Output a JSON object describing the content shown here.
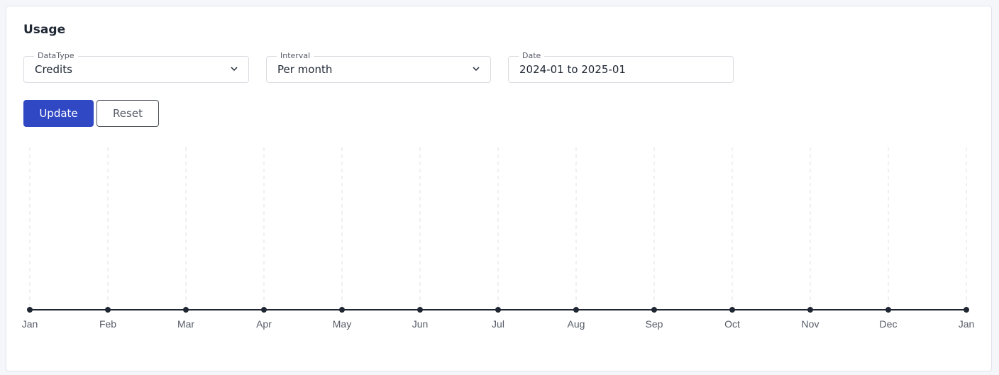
{
  "card": {
    "title": "Usage"
  },
  "filters": {
    "datatype": {
      "label": "DataType",
      "value": "Credits",
      "icon": "chevron-down-icon"
    },
    "interval": {
      "label": "Interval",
      "value": "Per month",
      "icon": "chevron-down-icon"
    },
    "date": {
      "label": "Date",
      "value": "2024-01 to 2025-01"
    }
  },
  "buttons": {
    "update": "Update",
    "reset": "Reset"
  },
  "colors": {
    "primary": "#3048c4",
    "line": "#1f2733",
    "grid": "#e0e0e0"
  },
  "chart_data": {
    "type": "line",
    "title": "",
    "xlabel": "",
    "ylabel": "",
    "categories": [
      "Jan",
      "Feb",
      "Mar",
      "Apr",
      "May",
      "Jun",
      "Jul",
      "Aug",
      "Sep",
      "Oct",
      "Nov",
      "Dec",
      "Jan"
    ],
    "series": [
      {
        "name": "Credits",
        "values": [
          0,
          0,
          0,
          0,
          0,
          0,
          0,
          0,
          0,
          0,
          0,
          0,
          0
        ]
      }
    ],
    "ylim": [
      0,
      1
    ],
    "grid": "vertical-dashed",
    "legend": "none"
  }
}
